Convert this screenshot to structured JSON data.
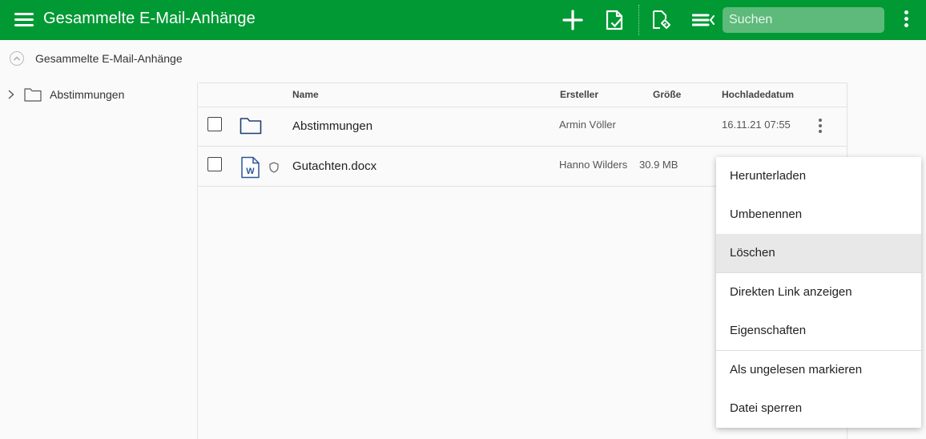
{
  "app": {
    "title": "Gesammelte E-Mail-Anhänge",
    "accent_color": "#019934"
  },
  "toolbar": {
    "icons": [
      "menu-icon",
      "add-icon",
      "document-check-icon",
      "tag-edit-icon",
      "list-view-icon",
      "more-vert-icon"
    ],
    "search_placeholder": "Suchen"
  },
  "breadcrumb": {
    "label": "Gesammelte E-Mail-Anhänge"
  },
  "tree": {
    "items": [
      {
        "label": "Abstimmungen",
        "icon": "folder-icon"
      }
    ]
  },
  "table": {
    "columns": {
      "name": "Name",
      "creator": "Ersteller",
      "size": "Größe",
      "date": "Hochladedatum"
    },
    "rows": [
      {
        "name": "Abstimmungen",
        "type": "folder",
        "creator": "Armin Völler",
        "size": "",
        "date": "16.11.21 07:55"
      },
      {
        "name": "Gutachten.docx",
        "type": "word-document",
        "creator": "Hanno Wilders",
        "size": "30.9 MB",
        "date": ""
      }
    ]
  },
  "context_menu": {
    "items": [
      {
        "label": "Herunterladen"
      },
      {
        "label": "Umbenennen"
      },
      {
        "label": "Löschen",
        "highlighted": true
      },
      {
        "label": "Direkten Link anzeigen"
      },
      {
        "label": "Eigenschaften"
      },
      {
        "label": "Als ungelesen markieren"
      },
      {
        "label": "Datei sperren"
      }
    ]
  }
}
